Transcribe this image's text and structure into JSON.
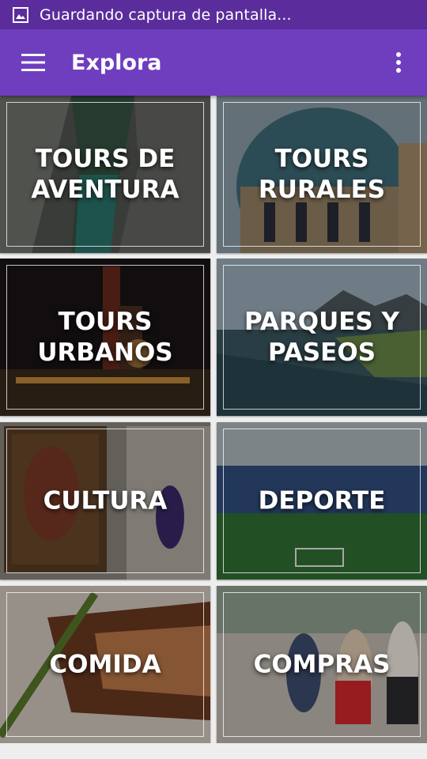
{
  "status_bar": {
    "notification_icon": "image-icon",
    "text": "Guardando captura de pantalla..."
  },
  "app_bar": {
    "title": "Explora",
    "menu_icon": "hamburger-menu-icon",
    "overflow_icon": "more-vert-icon"
  },
  "colors": {
    "status_bar": "#5b2d9c",
    "app_bar": "#6e3ebf",
    "background": "#eeeeee"
  },
  "categories": [
    {
      "label": "TOURS DE\nAVENTURA",
      "image": "canyon-river-photo"
    },
    {
      "label": "TOURS\nRURALES",
      "image": "basilica-dome-photo"
    },
    {
      "label": "TOURS\nURBANOS",
      "image": "night-industrial-park-photo"
    },
    {
      "label": "PARQUES Y\nPASEOS",
      "image": "river-walk-mountains-photo"
    },
    {
      "label": "CULTURA",
      "image": "museum-painting-photo"
    },
    {
      "label": "DEPORTE",
      "image": "stadium-photo"
    },
    {
      "label": "COMIDA",
      "image": "grilled-fish-dish-photo"
    },
    {
      "label": "COMPRAS",
      "image": "shopping-women-photo"
    }
  ]
}
